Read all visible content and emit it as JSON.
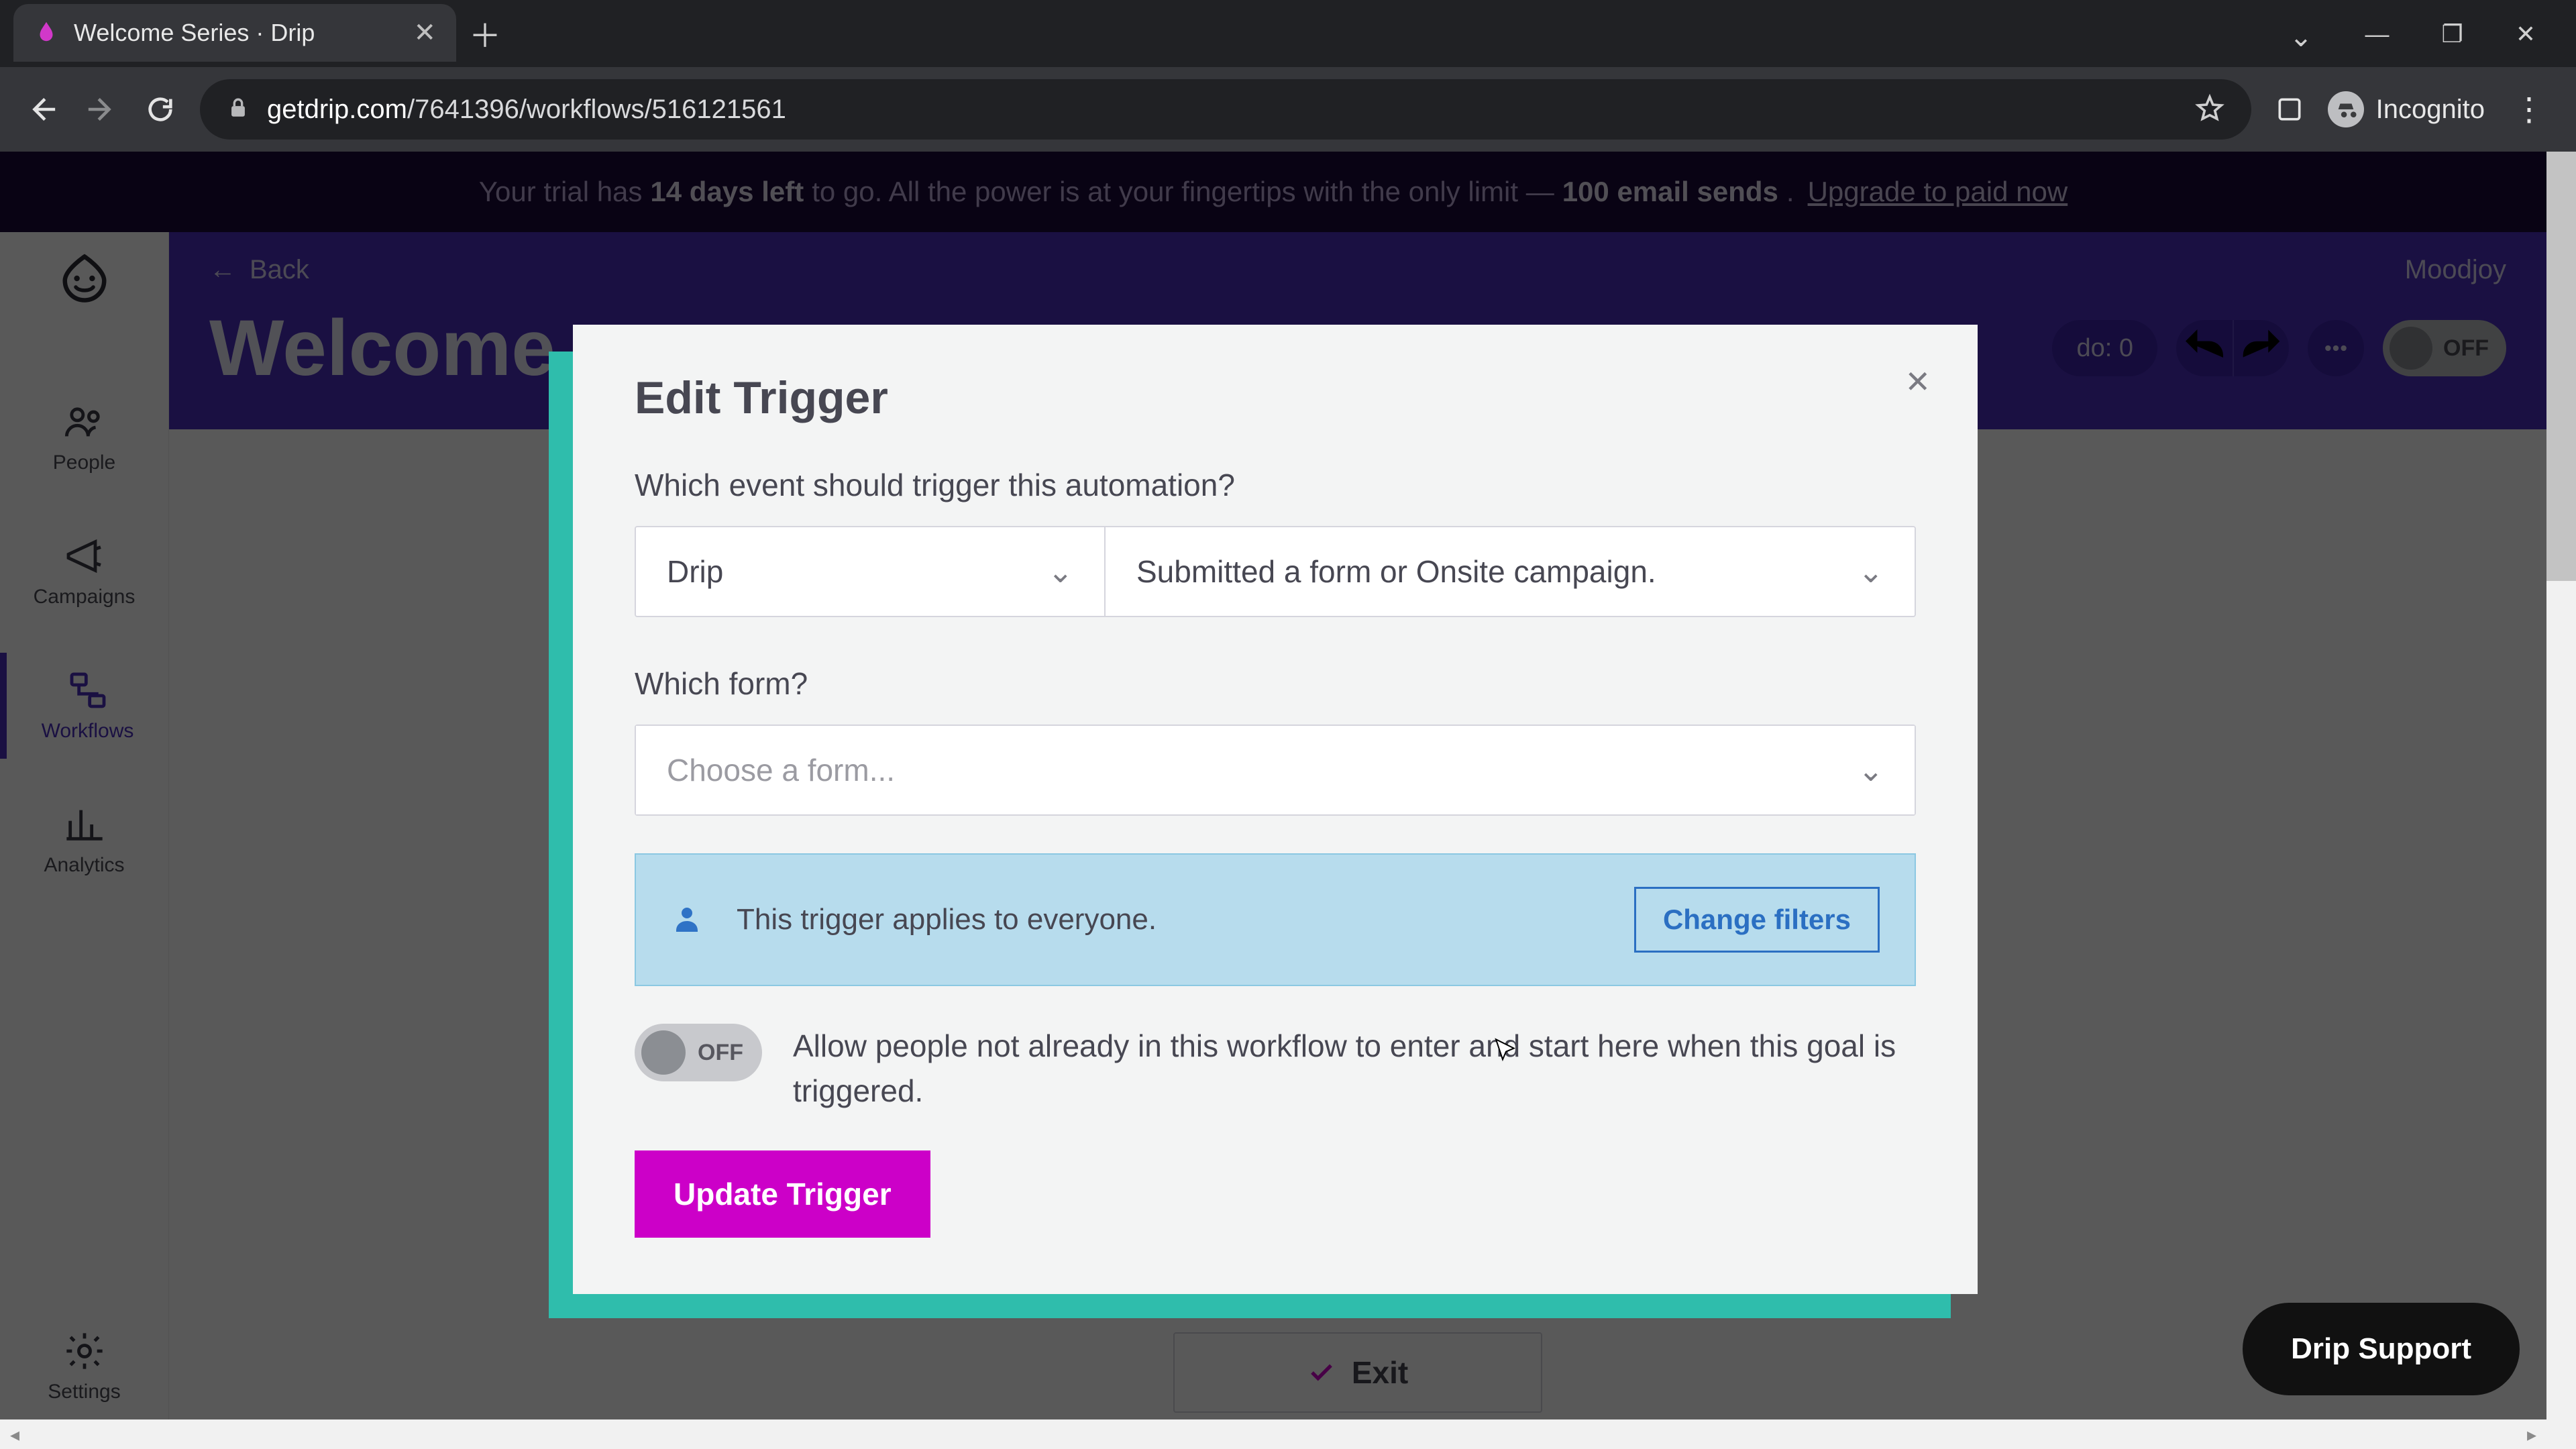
{
  "browser": {
    "tab_title": "Welcome Series · Drip",
    "url_domain": "getdrip.com",
    "url_path": "/7641396/workflows/516121561",
    "incognito_label": "Incognito"
  },
  "banner": {
    "pre": "Your trial has ",
    "bold1": "14 days left",
    "mid": " to go. All the power is at your fingertips with the only limit — ",
    "bold2": "100 email sends",
    "post": ". ",
    "link": "Upgrade to paid now"
  },
  "rail": {
    "people": "People",
    "campaigns": "Campaigns",
    "workflows": "Workflows",
    "analytics": "Analytics",
    "settings": "Settings"
  },
  "header": {
    "back": "Back",
    "title": "Welcome",
    "todo": "do: 0",
    "toggle": "OFF",
    "account": "Moodjoy"
  },
  "exit_label": "Exit",
  "modal": {
    "title": "Edit Trigger",
    "q_event": "Which event should trigger this automation?",
    "provider": "Drip",
    "event": "Submitted a form or Onsite campaign.",
    "q_form": "Which form?",
    "form_placeholder": "Choose a form...",
    "filter_text": "This trigger applies to everyone.",
    "filter_button": "Change filters",
    "allow_toggle": "OFF",
    "allow_text": "Allow people not already in this workflow to enter and start here when this goal is triggered.",
    "submit": "Update Trigger"
  },
  "support": "Drip Support"
}
